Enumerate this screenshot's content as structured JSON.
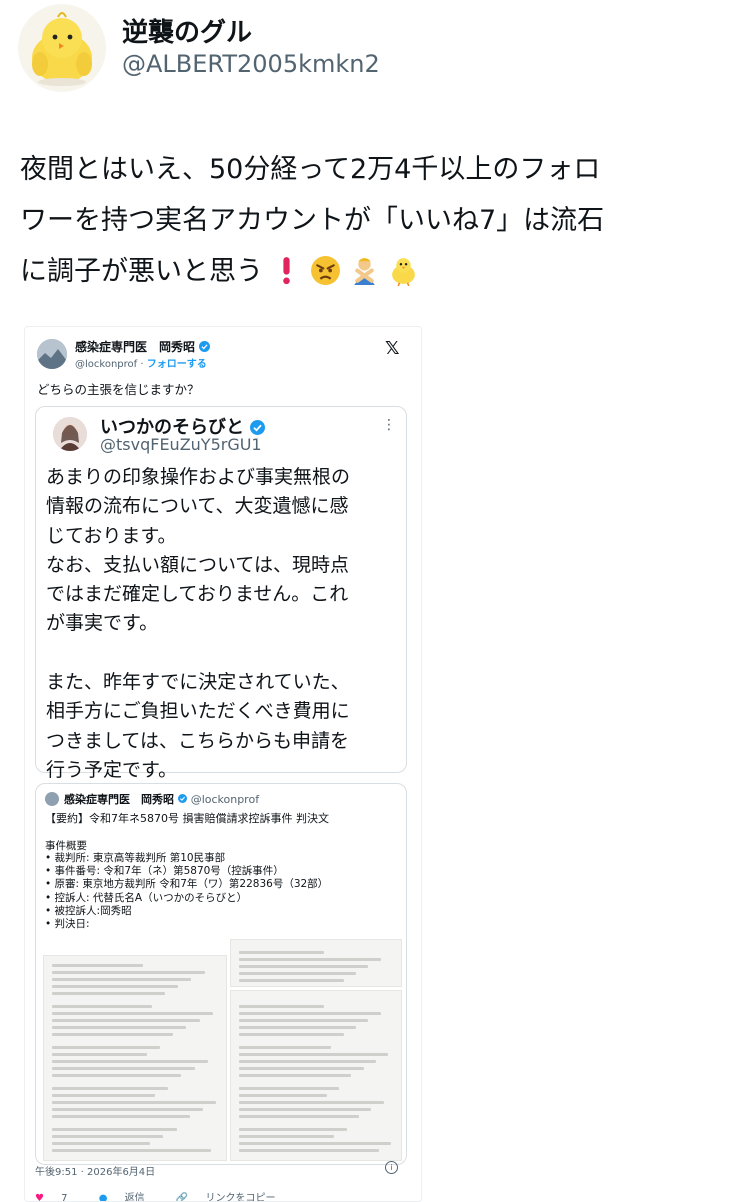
{
  "author": {
    "name": "逆襲のグル",
    "handle": "@ALBERT2005kmkn2",
    "avatar_icon": "chick-avatar-icon"
  },
  "post": {
    "line1": "夜間とはいえ、50分経って2万4千以上のフォロ",
    "line2": "ワーを持つ実名アカウントが「いいね7」は流石",
    "line3": "に調子が悪いと思う",
    "emojis": [
      "exclamation-icon",
      "angry-face-icon",
      "person-gesturing-no-icon",
      "chick-icon"
    ]
  },
  "embed": {
    "author_name": "感染症専門医　岡秀昭",
    "author_handle": "@lockonprof",
    "follow_label": "フォローする",
    "question": "どちらの主張を信じますか？",
    "quoted": {
      "name": "いつかのそらびと",
      "handle": "@tsvqFEuZuY5rGU1",
      "text": "あまりの印象操作および事実無根の\n情報の流布について、大変遺憾に感\nじております。\nなお、支払い額については、現時点\nではまだ確定しておりません。これ\nが事実です。\n\nまた、昨年すでに決定されていた、\n相手方にご負担いただくべき費用に\nつきましては、こちらからも申請を\n行う予定です。"
    },
    "doc": {
      "name": "感染症専門医　岡秀昭",
      "handle": "@lockonprof",
      "title": "【要約】令和7年ネ5870号 損害賠償請求控訴事件 判決文",
      "section": "事件概要",
      "items": [
        "裁判所: 東京高等裁判所 第10民事部",
        "事件番号: 令和7年（ネ）第5870号（控訴事件）",
        "原審: 東京地方裁判所 令和7年（ワ）第22836号（32部）",
        "控訴人: 代替氏名A（いつかのそらびと）",
        "被控訴人:岡秀昭",
        "判決日:"
      ]
    },
    "timestamp": "午後9:51 · 2026年6月4日",
    "actions": {
      "likes": "7",
      "reply": "返信",
      "copy_link": "リンクをコピー"
    }
  },
  "colors": {
    "accent": "#1d9bf0",
    "like": "#f91880",
    "text": "#0f1419",
    "muted": "#536471",
    "alert": "#e0245e"
  }
}
